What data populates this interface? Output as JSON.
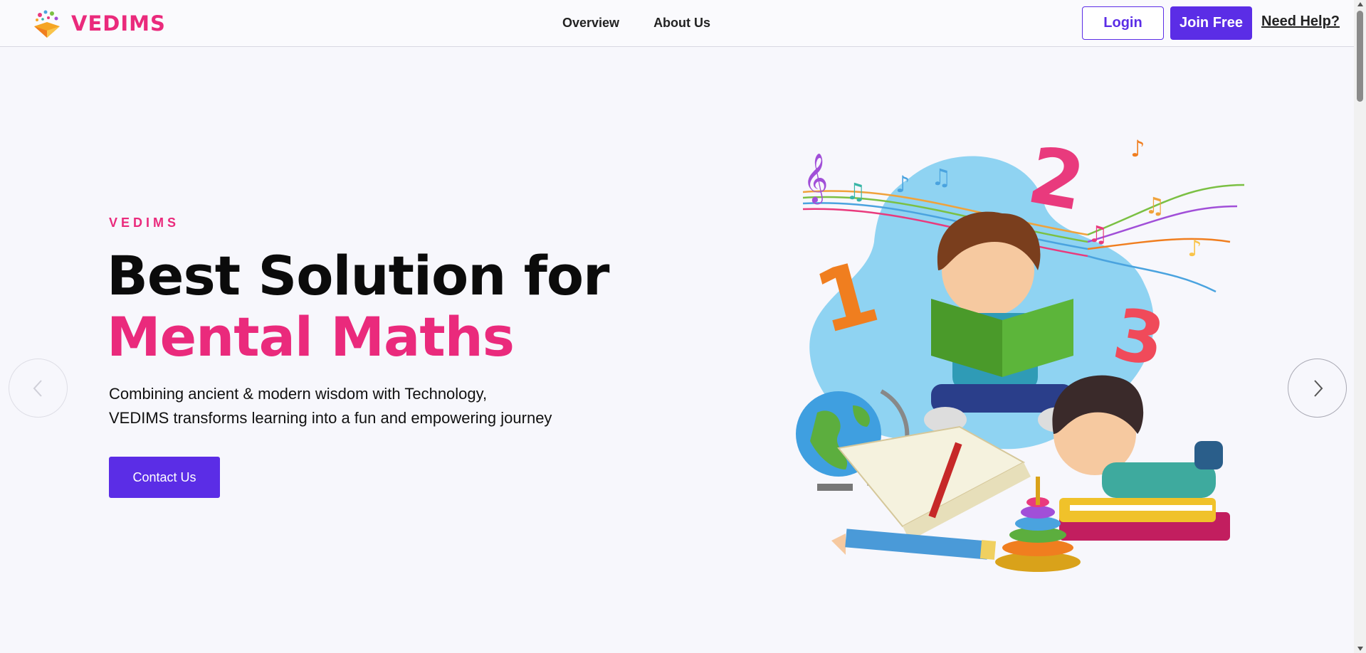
{
  "header": {
    "brand": "VEDIMS",
    "nav": [
      {
        "label": "Overview"
      },
      {
        "label": "About Us"
      }
    ],
    "login_label": "Login",
    "join_label": "Join Free",
    "help_label": "Need Help?"
  },
  "hero": {
    "eyebrow": "VEDIMS",
    "headline_line1": "Best Solution for",
    "headline_line2": "Mental Maths",
    "subtext_line1": "Combining ancient & modern wisdom with Technology,",
    "subtext_line2": "VEDIMS transforms learning into a fun and empowering journey",
    "cta_label": "Contact Us"
  },
  "colors": {
    "brand_pink": "#ea2a7c",
    "primary_purple": "#5b2de6",
    "background": "#f7f7fc"
  },
  "icons": {
    "prev": "chevron-left-icon",
    "next": "chevron-right-icon",
    "logo": "vedims-logo-icon"
  }
}
